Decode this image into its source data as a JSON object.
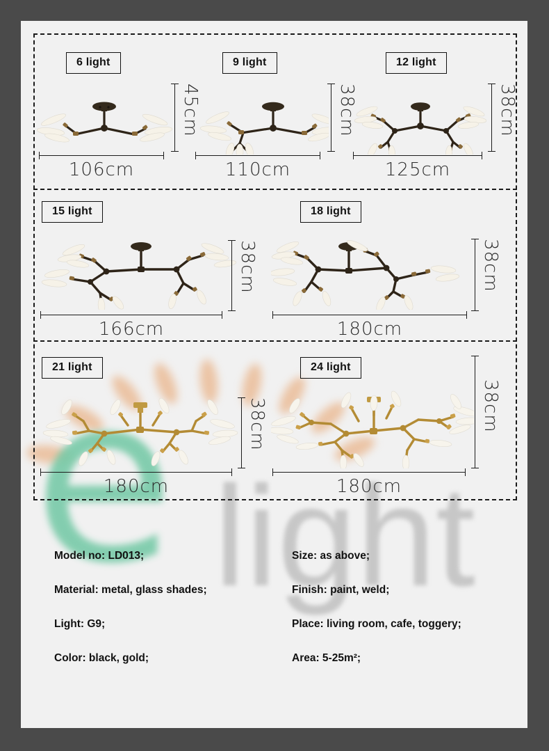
{
  "page": {
    "background_outer": "#4a4a4a",
    "background_page": "#f1f1f1"
  },
  "watermark": {
    "letter": "e",
    "word": "light",
    "letter_color": "#74c9a6",
    "word_color": "#b9b9b9",
    "ray_color": "#e8a977"
  },
  "variants": [
    {
      "label": "6 light",
      "width": "106cm",
      "height": "45cm",
      "finish": "black",
      "lights": 6
    },
    {
      "label": "9 light",
      "width": "110cm",
      "height": "38cm",
      "finish": "black",
      "lights": 9
    },
    {
      "label": "12 light",
      "width": "125cm",
      "height": "38cm",
      "finish": "black",
      "lights": 12
    },
    {
      "label": "15 light",
      "width": "166cm",
      "height": "38cm",
      "finish": "black",
      "lights": 15
    },
    {
      "label": "18 light",
      "width": "180cm",
      "height": "38cm",
      "finish": "black",
      "lights": 18
    },
    {
      "label": "21 light",
      "width": "180cm",
      "height": "38cm",
      "finish": "gold",
      "lights": 21
    },
    {
      "label": "24 light",
      "width": "180cm",
      "height": "38cm",
      "finish": "gold",
      "lights": 24
    }
  ],
  "specs": {
    "left": [
      "Model no: LD013;",
      "Material: metal, glass shades;",
      "Light: G9;",
      "Color: black, gold;"
    ],
    "right": [
      "Size: as above;",
      "Finish: paint, weld;",
      "Place: living room, cafe, toggery;",
      "Area: 5-25m²;"
    ]
  }
}
